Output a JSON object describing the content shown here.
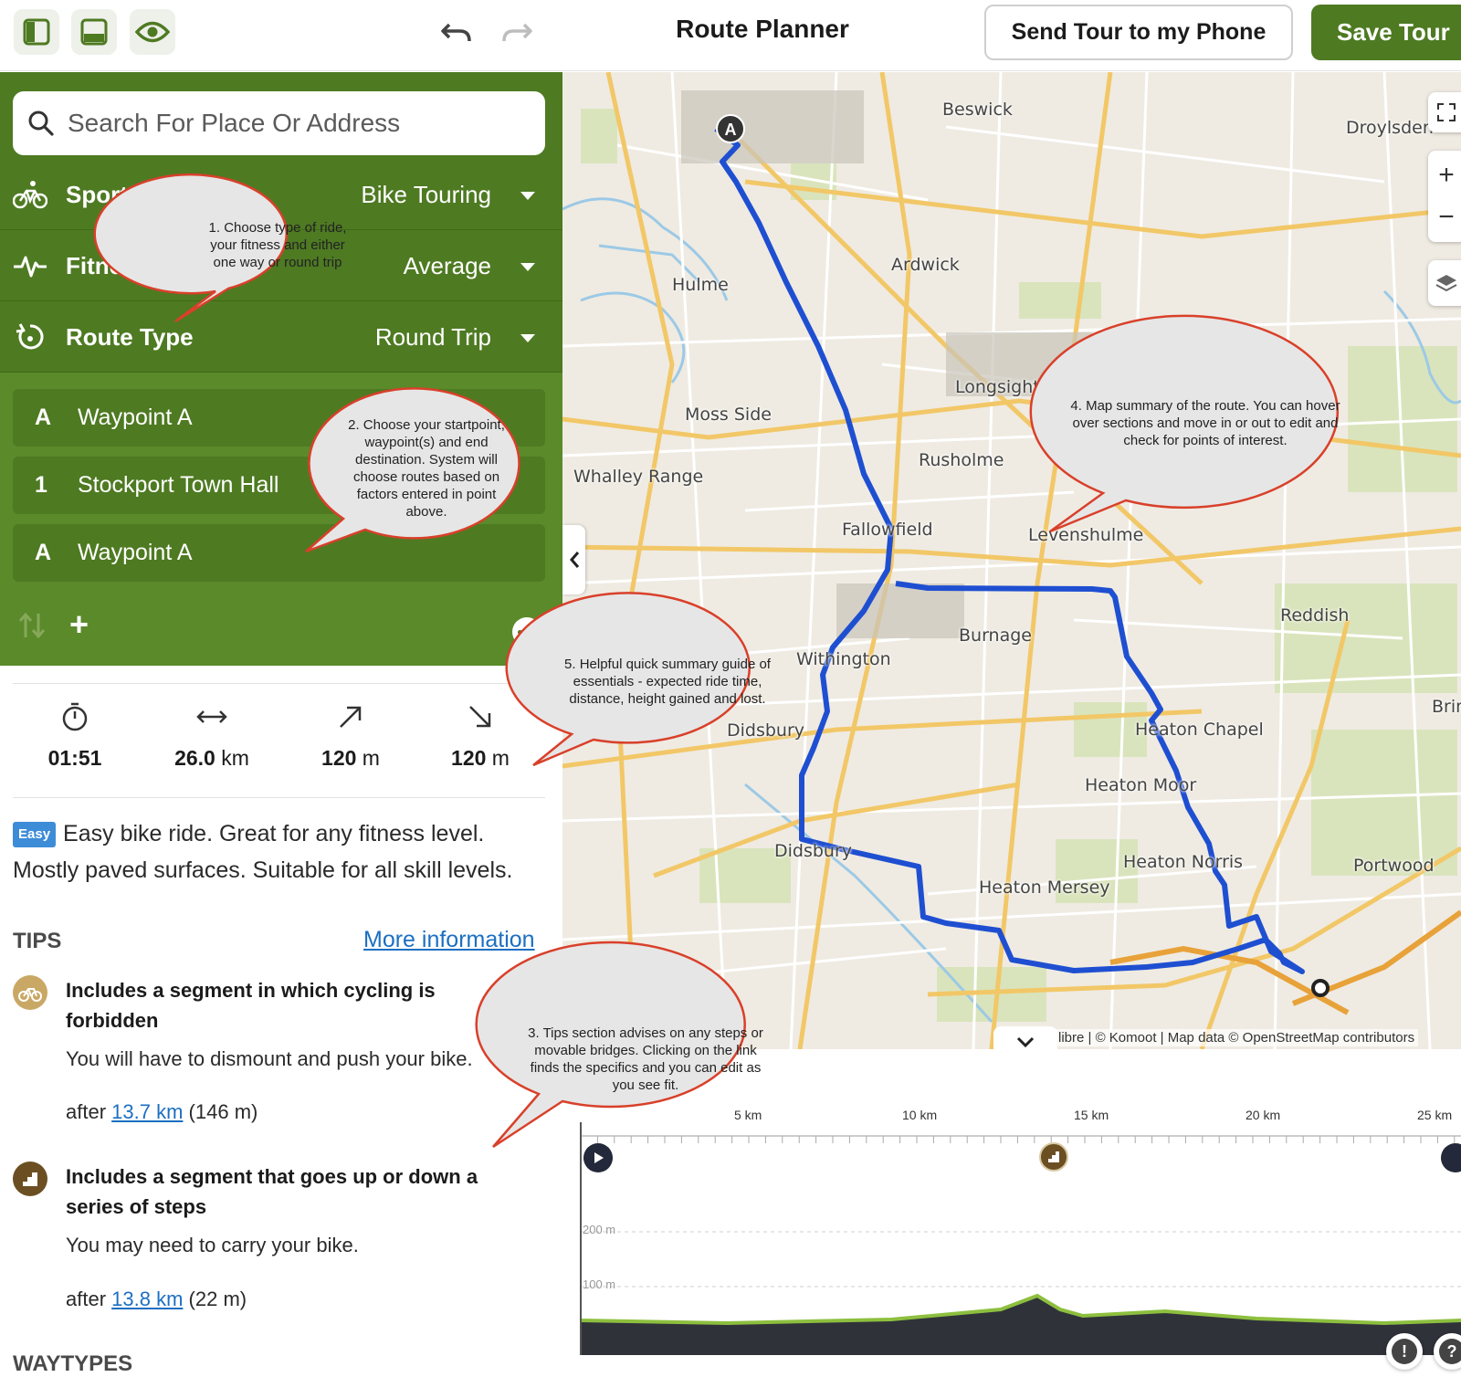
{
  "header": {
    "title": "Route Planner",
    "send_label": "Send Tour to my Phone",
    "save_label": "Save Tour",
    "icons": [
      "sidebar-panel-icon",
      "bottom-panel-icon",
      "eye-icon",
      "undo-icon",
      "redo-icon"
    ]
  },
  "search": {
    "placeholder": "Search For Place Or Address"
  },
  "options": {
    "sport": {
      "label": "Sport",
      "value": "Bike Touring"
    },
    "fitness": {
      "label": "Fitness",
      "value": "Average"
    },
    "route_type": {
      "label": "Route Type",
      "value": "Round Trip"
    }
  },
  "waypoints": [
    {
      "tag": "A",
      "name": "Waypoint A"
    },
    {
      "tag": "1",
      "name": "Stockport Town Hall"
    },
    {
      "tag": "A",
      "name": "Waypoint A"
    }
  ],
  "stats": {
    "duration": "01:51",
    "distance_value": "26.0",
    "distance_unit": "km",
    "uphill_value": "120",
    "uphill_unit": "m",
    "downhill_value": "120",
    "downhill_unit": "m"
  },
  "difficulty": {
    "badge": "Easy",
    "text": "Easy bike ride. Great for any fitness level. Mostly paved surfaces. Suitable for all skill levels."
  },
  "tips": {
    "heading": "TIPS",
    "more_info": "More information",
    "items": [
      {
        "title": "Includes a segment in which cycling is forbidden",
        "desc": "You will have to dismount and push your bike.",
        "after_prefix": "after",
        "after_link": "13.7 km",
        "after_suffix": "(146 m)"
      },
      {
        "title": "Includes a segment that goes up or down a series of steps",
        "desc": "You may need to carry your bike.",
        "after_prefix": "after",
        "after_link": "13.8 km",
        "after_suffix": "(22 m)"
      }
    ]
  },
  "waytypes_heading": "WAYTYPES",
  "map": {
    "labels": [
      "Beswick",
      "Droylsden",
      "Ardwick",
      "Hulme",
      "Longsight",
      "Moss Side",
      "Rusholme",
      "Whalley Range",
      "Fallowfield",
      "Levenshulme",
      "Reddish",
      "Burnage",
      "Withington",
      "Didsbury",
      "Heaton Chapel",
      "Heaton Moor",
      "Didsbury",
      "Heaton Norris",
      "Heaton Mersey",
      "Portwood",
      "Brin"
    ],
    "start_marker": "A",
    "attribution": "libre | © Komoot | Map data © OpenStreetMap contributors",
    "route_color": "#1f4fd1"
  },
  "elevation": {
    "x_ticks": [
      "5 km",
      "10 km",
      "15 km",
      "20 km",
      "25 km"
    ],
    "y_ticks": [
      "200 m",
      "100 m"
    ]
  },
  "callouts": [
    "1. Choose type of ride, your fitness and either one way or round trip",
    "2. Choose your startpoint, waypoint(s) and end destination. System will choose routes based on factors entered in point above.",
    "3. Tips section advises on any steps or movable bridges. Clicking on the link finds the specifics and you can edit as you see fit.",
    "4. Map summary of the route. You can hover over sections and move in or out to edit and check for points of interest.",
    "5. Helpful quick summary guide of essentials - expected ride time, distance, height gained and lost."
  ],
  "colors": {
    "brand_green": "#4e7a22",
    "link_blue": "#1c6fc2",
    "callout_border": "#d9402a",
    "callout_fill": "#e6e6e6"
  }
}
